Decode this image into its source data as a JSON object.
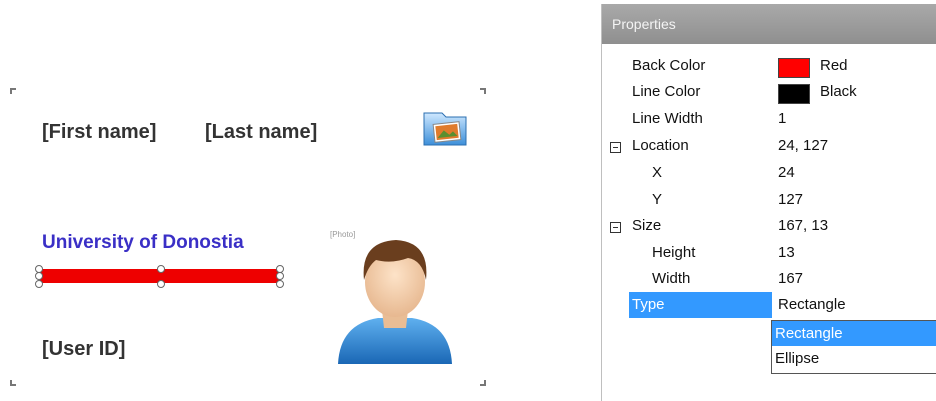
{
  "canvas": {
    "first_name": "[First name]",
    "last_name": "[Last name]",
    "university": "University of Donostia",
    "user_id": "[User ID]",
    "photo_label": "[Photo]"
  },
  "panel": {
    "title": "Properties",
    "rows": [
      {
        "name": "Back Color",
        "value": "Red",
        "swatch": "#ff0000"
      },
      {
        "name": "Line Color",
        "value": "Black",
        "swatch": "#000000"
      },
      {
        "name": "Line Width",
        "value": "1"
      },
      {
        "name": "Location",
        "value": "24, 127"
      },
      {
        "name": "X",
        "value": "24"
      },
      {
        "name": "Y",
        "value": "127"
      },
      {
        "name": "Size",
        "value": "167, 13"
      },
      {
        "name": "Height",
        "value": "13"
      },
      {
        "name": "Width",
        "value": "167"
      },
      {
        "name": "Type",
        "value": "Rectangle"
      }
    ],
    "dropdown_options": [
      "Rectangle",
      "Ellipse"
    ]
  },
  "colors": {
    "selection": "#3399ff",
    "university_text": "#3a2fc6",
    "shape_fill": "#ee0000"
  }
}
